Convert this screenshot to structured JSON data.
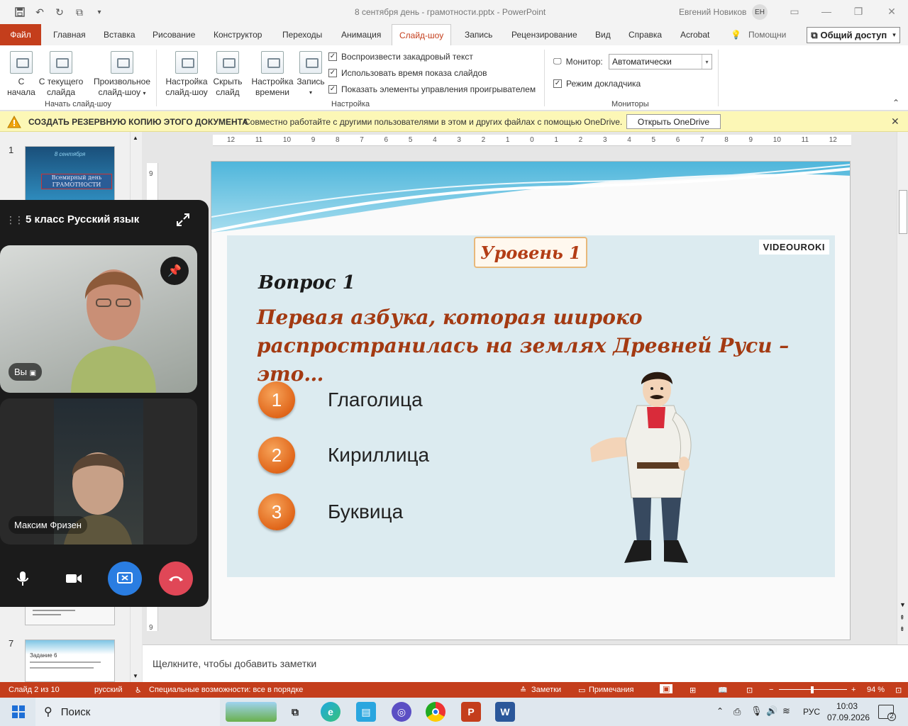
{
  "app": {
    "document_title": "8 сентября день - грамотности.pptx",
    "app_name": "PowerPoint",
    "user_name": "Евгений Новиков",
    "user_initials": "ЕН"
  },
  "tabs": [
    {
      "label": "Файл"
    },
    {
      "label": "Главная"
    },
    {
      "label": "Вставка"
    },
    {
      "label": "Рисование"
    },
    {
      "label": "Конструктор"
    },
    {
      "label": "Переходы"
    },
    {
      "label": "Анимация"
    },
    {
      "label": "Слайд-шоу"
    },
    {
      "label": "Запись"
    },
    {
      "label": "Рецензирование"
    },
    {
      "label": "Вид"
    },
    {
      "label": "Справка"
    },
    {
      "label": "Acrobat"
    }
  ],
  "search_label": "Помощни",
  "share_label": "Общий доступ",
  "ribbon": {
    "start_group": {
      "label": "Начать слайд-шоу",
      "from_start": [
        "С",
        "начала"
      ],
      "from_current": [
        "С текущего",
        "слайда"
      ],
      "custom": [
        "Произвольное",
        "слайд-шоу"
      ]
    },
    "setup_group": {
      "label": "Настройка",
      "setup_show": [
        "Настройка",
        "слайд-шоу"
      ],
      "hide_slide": [
        "Скрыть",
        "слайд"
      ],
      "rehearse": [
        "Настройка",
        "времени"
      ],
      "record": "Запись",
      "checks": [
        "Воспроизвести закадровый текст",
        "Использовать время показа слайдов",
        "Показать элементы управления проигрывателем"
      ]
    },
    "monitors_group": {
      "label": "Мониторы",
      "monitor_label": "Монитор:",
      "monitor_value": "Автоматически",
      "presenter_view": "Режим докладчика"
    }
  },
  "notification": {
    "title": "СОЗДАТЬ РЕЗЕРВНУЮ КОПИЮ ЭТОГО ДОКУМЕНТА",
    "message": "Совместно работайте с другими пользователями в этом и других файлах с помощью OneDrive.",
    "button": "Открыть OneDrive"
  },
  "thumbnails": [
    {
      "num": "1",
      "line1": "8 сентября",
      "line2": "Всемирный день",
      "line3": "ГРАМОТНОСТИ"
    },
    {
      "num": "7",
      "title": "Задание 6"
    }
  ],
  "ruler_ticks": [
    "12",
    "11",
    "10",
    "9",
    "8",
    "7",
    "6",
    "5",
    "4",
    "3",
    "2",
    "1",
    "0",
    "1",
    "2",
    "3",
    "4",
    "5",
    "6",
    "7",
    "8",
    "9",
    "10",
    "11",
    "12"
  ],
  "slide": {
    "level": "Уровень 1",
    "logo": "VIDEOUROKI",
    "question_title": "Вопрос 1",
    "question_text": "Первая азбука, которая широко распространилась на землях Древней Руси – это…",
    "answers": [
      {
        "num": "1",
        "text": "Глаголица"
      },
      {
        "num": "2",
        "text": "Кириллица"
      },
      {
        "num": "3",
        "text": "Буквица"
      }
    ]
  },
  "notes_placeholder": "Щелкните, чтобы добавить заметки",
  "status": {
    "slide_info": "Слайд 2 из 10",
    "language": "русский",
    "accessibility": "Специальные возможности: все в порядке",
    "notes": "Заметки",
    "comments": "Примечания",
    "zoom": "94 %"
  },
  "taskbar": {
    "search": "Поиск",
    "lang": "РУС",
    "time": "10:03",
    "date": "07.09.2026",
    "notif_count": "2"
  },
  "call": {
    "title": "5 класс Русский язык",
    "self_label": "Вы",
    "participant": "Максим Фризен"
  }
}
